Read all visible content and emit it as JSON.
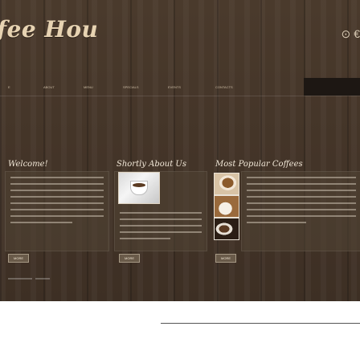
{
  "header": {
    "logo_text": "fee House",
    "icon_right": "search-icon"
  },
  "nav": {
    "items": [
      {
        "label": "E"
      },
      {
        "label": "ABOUT"
      },
      {
        "label": "MENU"
      },
      {
        "label": "SPECIALS"
      },
      {
        "label": "EVENTS"
      },
      {
        "label": "CONTACTS"
      }
    ]
  },
  "sections": [
    {
      "title": "Welcome!"
    },
    {
      "title": "Shortly About Us"
    },
    {
      "title": "Most Popular Coffees"
    }
  ],
  "buttons": [
    {
      "label": "more"
    },
    {
      "label": "more"
    },
    {
      "label": "more"
    }
  ]
}
